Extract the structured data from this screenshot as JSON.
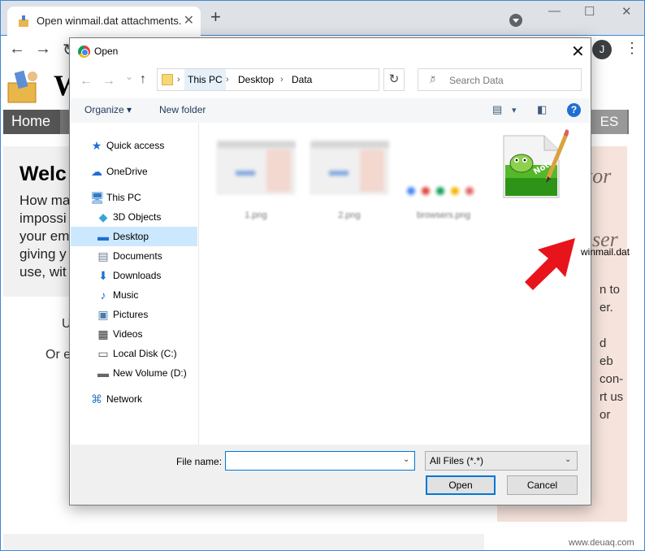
{
  "browser": {
    "tab_title": "Open winmail.dat attachments.",
    "tab_close": "✕",
    "new_tab": "+",
    "minimize": "—",
    "maximize": "☐",
    "close": "✕",
    "back": "←",
    "forward": "→",
    "profile_initial": "J",
    "menu": "⋮"
  },
  "page": {
    "site_title_initial": "W",
    "nav_home": "Home",
    "nav_es": "ES",
    "welcome_title": "Welc",
    "welcome_lines": [
      "How ma",
      "impossi",
      "your em",
      "giving y",
      "use, wit"
    ],
    "line_u": "U",
    "line_or": "Or e",
    "ad_script_1": "tor",
    "ad_script_2": "user",
    "ad_lines": [
      "n to",
      "er.",
      "",
      "d",
      "eb",
      "con-",
      "rt us",
      "or"
    ],
    "watermark": "www.deuaq.com"
  },
  "dialog": {
    "title": "Open",
    "close": "✕",
    "nav_back": "←",
    "nav_forward": "→",
    "nav_recent": "⌄",
    "nav_up": "↑",
    "breadcrumb": [
      "This PC",
      "Desktop",
      "Data"
    ],
    "crumb_sep": "›",
    "dropdown": "⌄",
    "refresh": "↻",
    "search_placeholder": "Search Data",
    "organize": "Organize ▾",
    "new_folder": "New folder",
    "view_dd": "▾",
    "help": "?",
    "nav_items": [
      {
        "label": "Quick access",
        "icon": "★"
      },
      {
        "label": "OneDrive",
        "icon": "☁"
      },
      {
        "label": "This PC",
        "icon": "🖥"
      },
      {
        "label": "3D Objects",
        "icon": "◆"
      },
      {
        "label": "Desktop",
        "icon": "▬"
      },
      {
        "label": "Documents",
        "icon": "▤"
      },
      {
        "label": "Downloads",
        "icon": "⬇"
      },
      {
        "label": "Music",
        "icon": "♪"
      },
      {
        "label": "Pictures",
        "icon": "▣"
      },
      {
        "label": "Videos",
        "icon": "▦"
      },
      {
        "label": "Local Disk (C:)",
        "icon": "▭"
      },
      {
        "label": "New Volume (D:)",
        "icon": "▬"
      },
      {
        "label": "Network",
        "icon": "⌘"
      }
    ],
    "files": [
      {
        "label": "1.png"
      },
      {
        "label": "2.png"
      },
      {
        "label": "browsers.png"
      },
      {
        "label": "winmail.dat"
      }
    ],
    "file_name_label": "File name:",
    "file_name_value": "",
    "file_type": "All Files (*.*)",
    "open_button": "Open",
    "cancel_button": "Cancel"
  },
  "colors": {
    "selection": "#cce8ff",
    "accent": "#0078d7",
    "arrow": "#e8141b"
  }
}
